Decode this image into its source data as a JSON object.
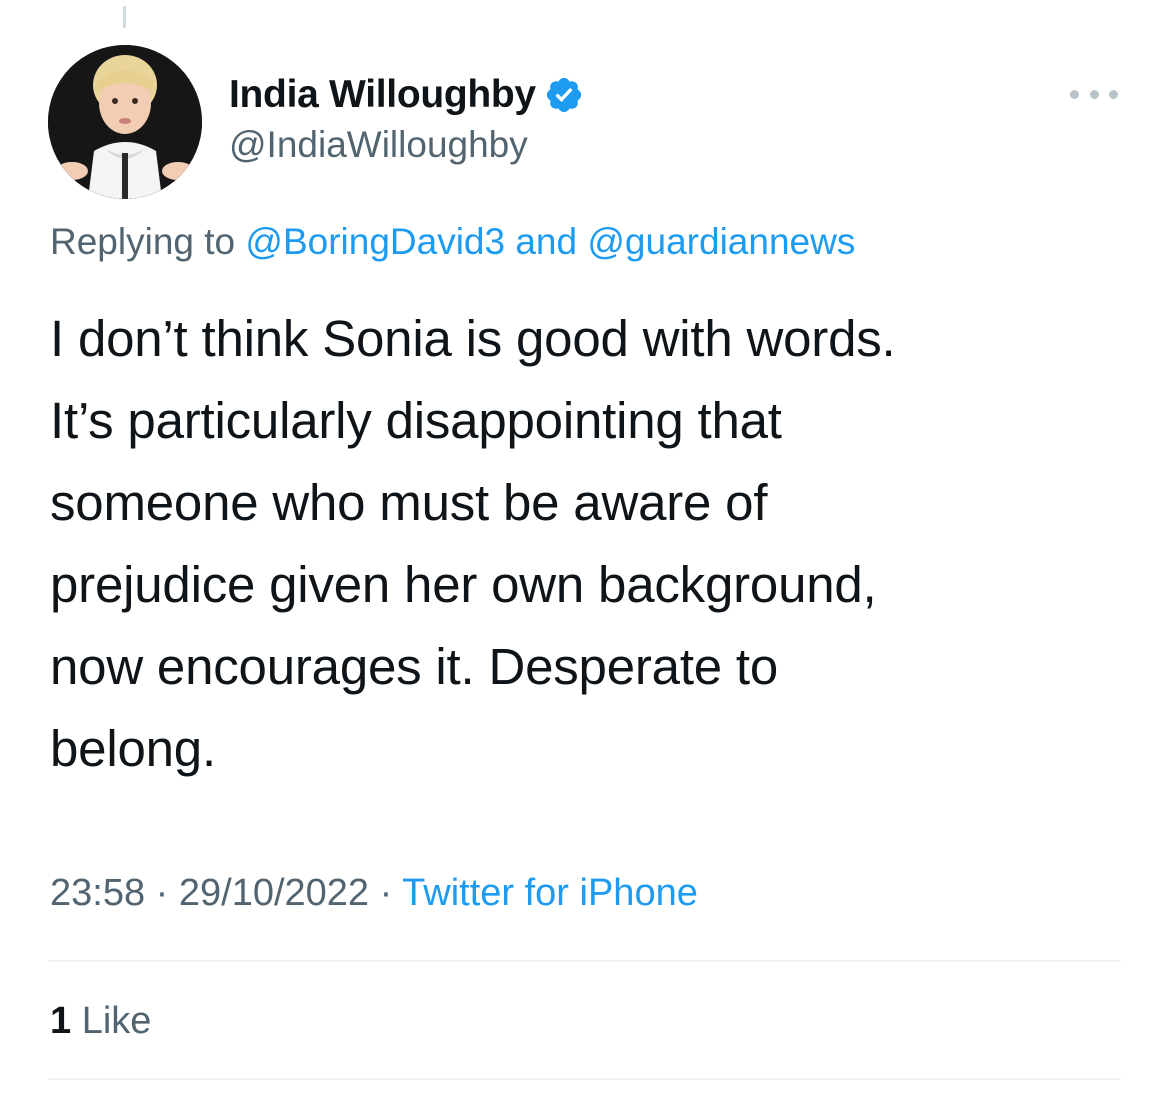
{
  "author": {
    "display_name": "India Willoughby",
    "handle": "@IndiaWilloughby",
    "verified": true
  },
  "reply_context": {
    "prefix": "Replying to ",
    "mention_1": "@BoringDavid3",
    "joiner": " and ",
    "mention_2": "@guardiannews"
  },
  "tweet": {
    "text": "I don’t think Sonia is good with words.\nIt’s particularly disappointing that\nsomeone who must be aware of\nprejudice given her own background,\nnow encourages it. Desperate to\nbelong."
  },
  "meta": {
    "time": "23:58",
    "separator": " · ",
    "date": "29/10/2022",
    "source": "Twitter for iPhone"
  },
  "stats": {
    "likes_count": "1",
    "likes_label": " Like"
  },
  "colors": {
    "accent": "#1d9bf0",
    "secondary_text": "#536471",
    "primary_text": "#0f1419",
    "divider": "#eff3f4"
  },
  "icons": {
    "verified": "verified-badge-icon",
    "more": "more-options-icon"
  }
}
